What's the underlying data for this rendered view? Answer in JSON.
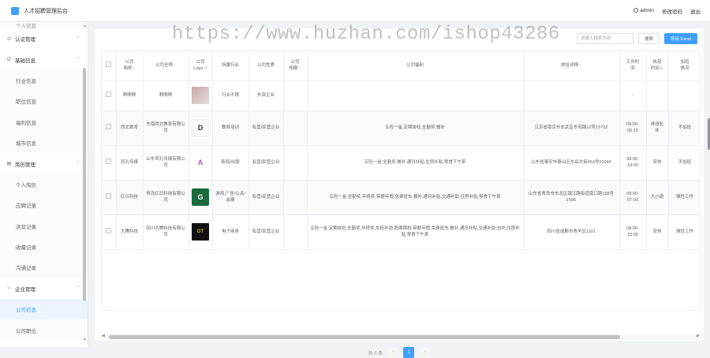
{
  "header": {
    "title": "人才招聘管理后台",
    "user": "admin",
    "change_password": "修改密码",
    "logout": "退出"
  },
  "watermark": "https://www.huzhan.com/ishop43286",
  "sidebar": {
    "partial_top": "个人信息",
    "items": [
      {
        "type": "group",
        "label": "认证管理",
        "icon": "shield-icon"
      },
      {
        "type": "group",
        "label": "基础信息",
        "icon": "edit-icon"
      },
      {
        "type": "sub",
        "label": "行业信息"
      },
      {
        "type": "sub",
        "label": "职位信息"
      },
      {
        "type": "sub",
        "label": "福利信息"
      },
      {
        "type": "sub",
        "label": "城市信息"
      },
      {
        "type": "group",
        "label": "简历管理",
        "icon": "document-icon"
      },
      {
        "type": "sub",
        "label": "个人简历"
      },
      {
        "type": "sub",
        "label": "应聘记录"
      },
      {
        "type": "sub",
        "label": "浏览记录"
      },
      {
        "type": "sub",
        "label": "收藏记录"
      },
      {
        "type": "sub",
        "label": "沟通记录"
      },
      {
        "type": "group",
        "label": "企业管理",
        "icon": "star-icon"
      },
      {
        "type": "sub",
        "label": "公司信息",
        "active": true
      },
      {
        "type": "sub",
        "label": "公司职位"
      }
    ]
  },
  "toolbar": {
    "search_placeholder": "请输入搜索内容",
    "search_label": "搜索",
    "export_label": "导出 Excel"
  },
  "table": {
    "columns": [
      {
        "label": "",
        "w": 18
      },
      {
        "label": "公司\n简称",
        "w": 34,
        "icon": "search"
      },
      {
        "label": "公司全称",
        "w": 58,
        "icon": "search"
      },
      {
        "label": "公司\nLogo",
        "w": 30,
        "icon": "sort"
      },
      {
        "label": "所属行业",
        "w": 46
      },
      {
        "label": "公司性质",
        "w": 44
      },
      {
        "label": "公司\n规模",
        "w": 30,
        "icon": "filter"
      },
      {
        "label": "公司福利",
        "w": 274
      },
      {
        "label": "地址详情",
        "w": 122,
        "icon": "search"
      },
      {
        "label": "工作时\n间",
        "w": 34
      },
      {
        "label": "休息\n时间",
        "w": 28,
        "icon": "sort"
      },
      {
        "label": "加班\n情况",
        "w": 42
      }
    ],
    "rows": [
      {
        "short": "啊啊啊",
        "full": "啊啊啊",
        "logo": "",
        "industry": "行业不限",
        "nature": "外资企业",
        "scale": "",
        "welfare": "",
        "address": "",
        "work_time": "-",
        "rest": "",
        "overtime": ""
      },
      {
        "short": "西北数育",
        "full": "东南西北教育有限公司",
        "logo": "D",
        "industry": "教育培训",
        "nature": "私营/民营企业",
        "scale": "",
        "welfare": "五险一金,定期体检,全勤奖,餐补",
        "address": "江苏省南京市玄武区东苑路12号15702",
        "work_time": "08:00-06:10",
        "rest": "排班轮休",
        "overtime": "不加班"
      },
      {
        "short": "风孔传媒",
        "full": "山东风孔传媒有限公司",
        "logo": "A",
        "industry": "新闻/出版",
        "nature": "私营/民营企业",
        "scale": "",
        "welfare": "五险一金,全勤奖,餐补,通讯补贴,住房补贴,零食下午茶",
        "address": "山东省泰安市泰山区东岳大街453号91044",
        "work_time": "08:00-18:00",
        "rest": "双休",
        "overtime": "不加班"
      },
      {
        "short": "红日科技",
        "full": "青岛红日科技有限公司",
        "logo": "G",
        "industry": "游戏,广告/公关/会展",
        "nature": "私营/民营企业",
        "scale": "",
        "welfare": "五险一金,全勤奖,年终奖,带薪年假,免费班车,餐补,通讯补贴,交通补助,住房补贴,零食下午茶",
        "address": "山东省青岛市市北区镇江路街道南口路198号1506",
        "work_time": "09:00-07:00",
        "rest": "大小周",
        "overtime": "弹性工作"
      },
      {
        "short": "大腾科技",
        "full": "四川大腾科技有限公司",
        "logo": "DT",
        "industry": "电子商务",
        "nature": "私营/民营企业",
        "scale": "",
        "welfare": "五险一金,定期体检,全勤奖,年终奖,加班补助,股票期权,带薪年假,免费班车,餐补,通讯补贴,交通补助,包吃,住房补贴,零食下午茶",
        "address": "四川省成都市青羊区1101",
        "work_time": "08:00-18:00",
        "rest": "双休",
        "overtime": "弹性工作"
      }
    ]
  },
  "pagination": {
    "total": "共 5 条",
    "current": "1",
    "prev": "‹",
    "next": "›"
  }
}
